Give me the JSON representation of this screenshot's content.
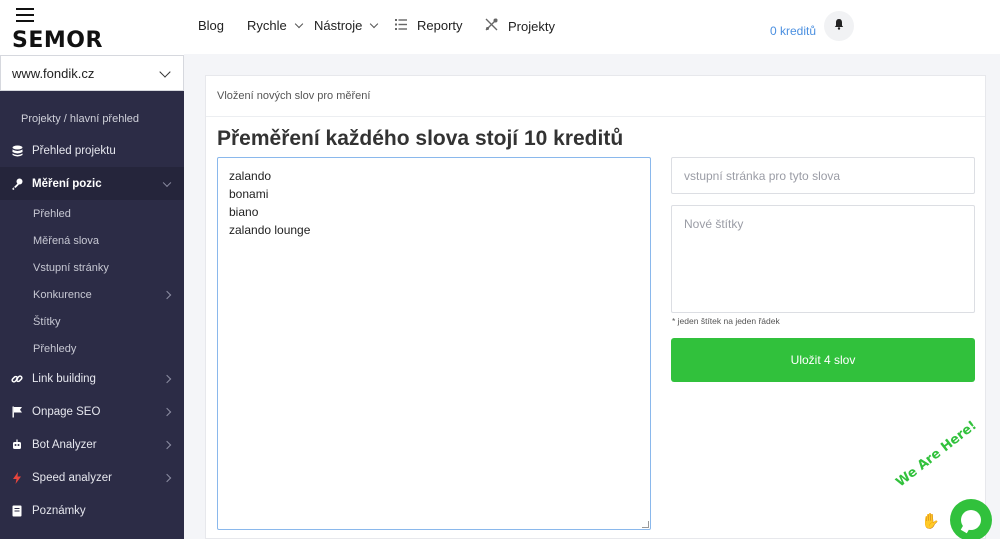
{
  "brand": {
    "logo_text": "SEMOR"
  },
  "site_selector": {
    "value": "www.fondik.cz"
  },
  "sidebar": {
    "breadcrumb": "Projekty / hlavní přehled",
    "items": [
      {
        "label": "Přehled projektu",
        "icon": "database-icon"
      },
      {
        "label": "Měření pozic",
        "icon": "key-icon",
        "active": true,
        "expanded": true
      },
      {
        "label": "Přehled",
        "sub": true
      },
      {
        "label": "Měřená slova",
        "sub": true
      },
      {
        "label": "Vstupní stránky",
        "sub": true
      },
      {
        "label": "Konkurence",
        "sub": true,
        "has_children": true
      },
      {
        "label": "Štítky",
        "sub": true
      },
      {
        "label": "Přehledy",
        "sub": true
      },
      {
        "label": "Link building",
        "icon": "link-icon",
        "has_children": true
      },
      {
        "label": "Onpage SEO",
        "icon": "flag-icon",
        "has_children": true
      },
      {
        "label": "Bot Analyzer",
        "icon": "bot-icon",
        "has_children": true
      },
      {
        "label": "Speed analyzer",
        "icon": "lightning-icon",
        "has_children": true
      },
      {
        "label": "Poznámky",
        "icon": "notebook-icon"
      }
    ]
  },
  "header": {
    "nav": [
      {
        "label": "Blog"
      },
      {
        "label": "Rychle",
        "dropdown": true
      },
      {
        "label": "Nástroje",
        "dropdown": true
      },
      {
        "label": "Reporty",
        "icon": "list-icon"
      },
      {
        "label": "Projekty",
        "icon": "projects-icon"
      }
    ],
    "credits": "0 kreditů"
  },
  "card": {
    "section_title": "Vložení nových slov pro měření",
    "heading": "Přeměření každého slova stojí 10 kreditů",
    "words_value": "zalando\nbonami\nbiano\nzalando lounge",
    "landing_placeholder": "vstupní stránka pro tyto slova",
    "tags_placeholder": "Nové štítky",
    "tags_hint": "* jeden štítek na jeden řádek",
    "save_label": "Uložit 4 slov"
  },
  "chat": {
    "label": "We Are Here!"
  },
  "colors": {
    "accent_green": "#31c13c",
    "sidebar_bg": "#2c2c46",
    "link_blue": "#4a8fe0"
  }
}
